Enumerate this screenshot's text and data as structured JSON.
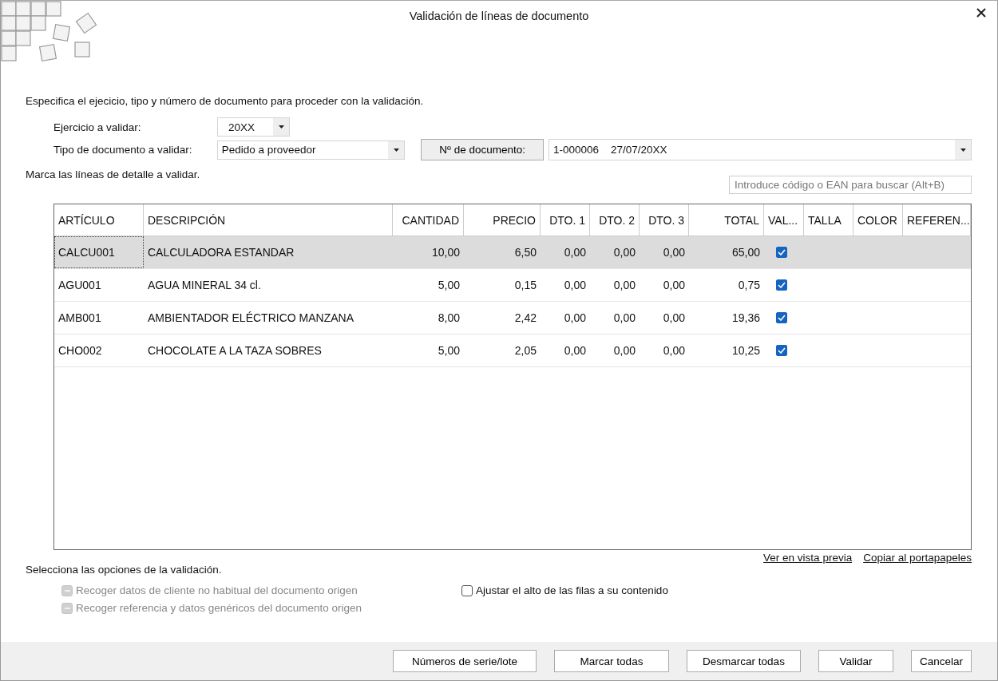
{
  "window": {
    "title": "Validación de líneas de documento"
  },
  "intro": "Especifica el ejecicio, tipo y número de documento para proceder con la validación.",
  "fields": {
    "year": {
      "label": "Ejercicio a validar:",
      "value": "20XX"
    },
    "doc_type": {
      "label": "Tipo de documento a validar:",
      "value": "Pedido a proveedor"
    },
    "doc_number": {
      "label": "Nº de documento:",
      "number": "1-000006",
      "date": "27/07/20XX"
    }
  },
  "lines_label": "Marca las líneas de detalle a validar.",
  "search": {
    "placeholder": "Introduce código o EAN para buscar (Alt+B)"
  },
  "table": {
    "columns": [
      "ARTÍCULO",
      "DESCRIPCIÓN",
      "CANTIDAD",
      "PRECIO",
      "DTO. 1",
      "DTO. 2",
      "DTO. 3",
      "TOTAL",
      "VAL...",
      "TALLA",
      "COLOR",
      "REFEREN..."
    ],
    "rows": [
      {
        "selected": true,
        "article": "CALCU001",
        "description": "CALCULADORA ESTANDAR",
        "quantity": "10,00",
        "price": "6,50",
        "dto1": "0,00",
        "dto2": "0,00",
        "dto3": "0,00",
        "total": "65,00",
        "valid": true
      },
      {
        "selected": false,
        "article": "AGU001",
        "description": "AGUA MINERAL 34 cl.",
        "quantity": "5,00",
        "price": "0,15",
        "dto1": "0,00",
        "dto2": "0,00",
        "dto3": "0,00",
        "total": "0,75",
        "valid": true
      },
      {
        "selected": false,
        "article": "AMB001",
        "description": "AMBIENTADOR ELÉCTRICO MANZANA",
        "quantity": "8,00",
        "price": "2,42",
        "dto1": "0,00",
        "dto2": "0,00",
        "dto3": "0,00",
        "total": "19,36",
        "valid": true
      },
      {
        "selected": false,
        "article": "CHO002",
        "description": "CHOCOLATE A LA TAZA SOBRES",
        "quantity": "5,00",
        "price": "2,05",
        "dto1": "0,00",
        "dto2": "0,00",
        "dto3": "0,00",
        "total": "10,25",
        "valid": true
      }
    ]
  },
  "links": [
    "Ver en vista previa",
    "Copiar al portapapeles"
  ],
  "options_label": "Selecciona las opciones de la validación.",
  "options": [
    {
      "label": "Recoger datos de cliente no habitual del documento origen",
      "disabled": true,
      "indeterminate": true,
      "checked": false
    },
    {
      "label": "Recoger referencia y datos genéricos del documento origen",
      "disabled": true,
      "indeterminate": true,
      "checked": false
    },
    {
      "label": "Ajustar el alto de las filas a su contenido",
      "disabled": false,
      "indeterminate": false,
      "checked": false
    }
  ],
  "buttons": [
    "Números de serie/lote",
    "Marcar todas",
    "Desmarcar todas",
    "Validar",
    "Cancelar"
  ]
}
